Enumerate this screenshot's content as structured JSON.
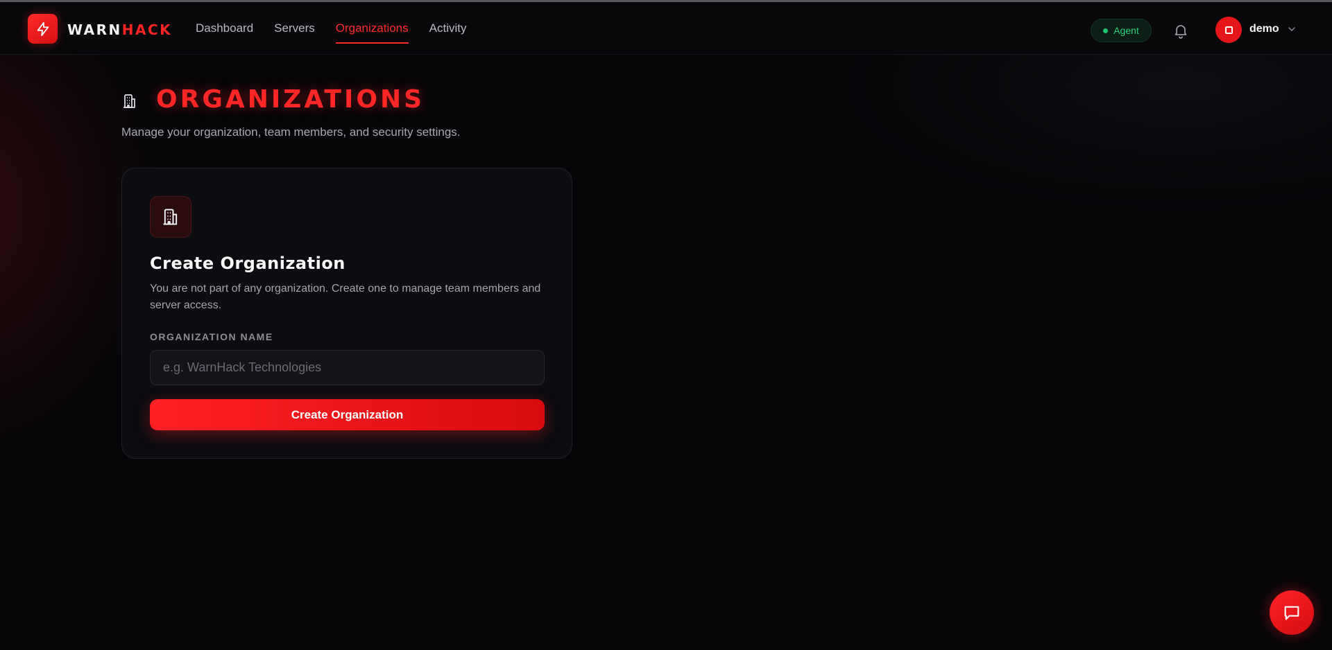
{
  "header": {
    "brand_part1": "WARN",
    "brand_part2": "HACK",
    "nav": [
      {
        "label": "Dashboard"
      },
      {
        "label": "Servers"
      },
      {
        "label": "Organizations"
      },
      {
        "label": "Activity"
      }
    ],
    "active_nav": "Organizations",
    "agent_label": "Agent",
    "username": "demo",
    "icons": {
      "logo": "lightning-bolt-icon",
      "notifications": "bell-icon",
      "user_menu": "chevron-down-icon"
    }
  },
  "page": {
    "title": "ORGANIZATIONS",
    "subtitle": "Manage your organization, team members, and security settings.",
    "title_icon": "building-icon"
  },
  "card": {
    "icon": "building-icon",
    "title": "Create Organization",
    "description": "You are not part of any organization. Create one to manage team members and server access.",
    "field_label": "ORGANIZATION NAME",
    "input_placeholder": "e.g. WarnHack Technologies",
    "input_value": "",
    "button_label": "Create Organization"
  },
  "chat": {
    "icon": "chat-bubble-icon"
  },
  "colors": {
    "accent": "#ff2626",
    "background": "#060609",
    "agent_status": "#2ad17a"
  }
}
